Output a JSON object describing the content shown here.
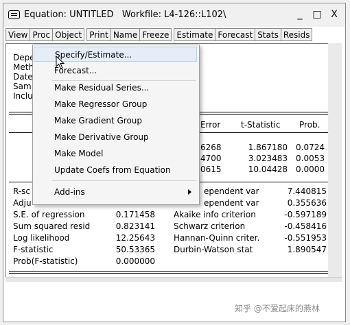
{
  "window": {
    "title": "Equation: UNTITLED",
    "workfile": "Workfile: L4-126::L102\\",
    "controls": [
      "_",
      "□",
      "X"
    ]
  },
  "toolbar": [
    "View",
    "Proc",
    "Object",
    "Print",
    "Name",
    "Freeze",
    "Estimate",
    "Forecast",
    "Stats",
    "Resids"
  ],
  "header_lines": [
    "Depe",
    "Meth",
    "Date",
    "Sam",
    "Inclu"
  ],
  "coef_table": {
    "headers": [
      "Error",
      "t-Statistic",
      "Prob."
    ],
    "rows": [
      {
        "se": "6268",
        "t": "1.867180",
        "p": "0.0724"
      },
      {
        "se": "4700",
        "t": "3.023483",
        "p": "0.0053"
      },
      {
        "se": "0615",
        "t": "10.04428",
        "p": "0.0000"
      }
    ]
  },
  "stats_left": [
    {
      "label": "R-sc",
      "value": ""
    },
    {
      "label": "Adju",
      "value": ""
    },
    {
      "label": "S.E. of regression",
      "value": "0.171458"
    },
    {
      "label": "Sum squared resid",
      "value": "0.823141"
    },
    {
      "label": "Log likelihood",
      "value": "12.25643"
    },
    {
      "label": "F-statistic",
      "value": "50.53365"
    },
    {
      "label": "Prob(F-statistic)",
      "value": "0.000000"
    }
  ],
  "stats_right": [
    {
      "label": "ependent var",
      "value": "7.440815"
    },
    {
      "label": "ependent var",
      "value": "0.355636"
    },
    {
      "label": "Akaike info criterion",
      "value": "-0.597189"
    },
    {
      "label": "Schwarz criterion",
      "value": "-0.458416"
    },
    {
      "label": "Hannan-Quinn criter.",
      "value": "-0.551953"
    },
    {
      "label": "Durbin-Watson stat",
      "value": "1.890547"
    }
  ],
  "menu": {
    "items": [
      "Specify/Estimate...",
      "Forecast...",
      "Make Residual Series...",
      "Make Regressor Group",
      "Make Gradient Group",
      "Make Derivative Group",
      "Make Model",
      "Update Coefs from Equation",
      "Add-ins"
    ]
  },
  "watermark": "知乎 @不爱起床的燕林"
}
